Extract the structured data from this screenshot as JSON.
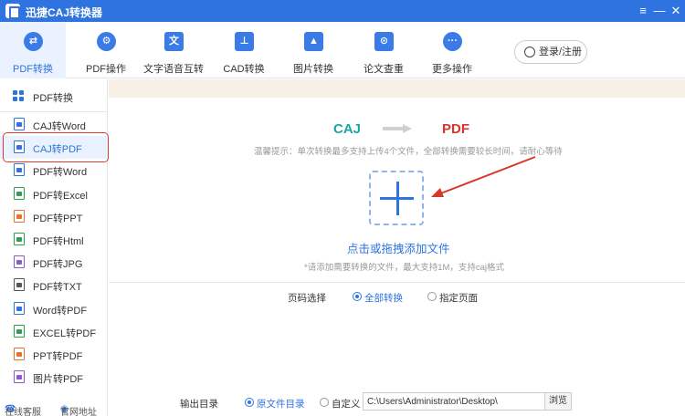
{
  "window": {
    "title": "迅捷CAJ转换器",
    "controls": {
      "menu": "≡",
      "minimize": "—",
      "close": "✕"
    }
  },
  "toolbar": {
    "tabs": [
      {
        "label": "PDF转换",
        "icon": "swap-icon",
        "active": true
      },
      {
        "label": "PDF操作",
        "icon": "gear-icon"
      },
      {
        "label": "文字语音互转",
        "icon": "speech-icon"
      },
      {
        "label": "CAD转换",
        "icon": "cad-icon"
      },
      {
        "label": "图片转换",
        "icon": "image-icon"
      },
      {
        "label": "论文查重",
        "icon": "search-doc-icon"
      },
      {
        "label": "更多操作",
        "icon": "more-icon"
      }
    ],
    "login_label": "登录/注册"
  },
  "sidebar": {
    "header": "PDF转换",
    "items": [
      {
        "label": "CAJ转Word",
        "color": "#2f73e0"
      },
      {
        "label": "CAJ转PDF",
        "color": "#2f73e0",
        "selected": true
      },
      {
        "label": "PDF转Word",
        "color": "#2f73e0"
      },
      {
        "label": "PDF转Excel",
        "color": "#2aa14a"
      },
      {
        "label": "PDF转PPT",
        "color": "#e8732a"
      },
      {
        "label": "PDF转Html",
        "color": "#2aa14a"
      },
      {
        "label": "PDF转JPG",
        "color": "#8e57d6"
      },
      {
        "label": "PDF转TXT",
        "color": "#555555"
      },
      {
        "label": "Word转PDF",
        "color": "#2f73e0"
      },
      {
        "label": "EXCEL转PDF",
        "color": "#2aa14a"
      },
      {
        "label": "PPT转PDF",
        "color": "#e8732a"
      },
      {
        "label": "图片转PDF",
        "color": "#8e57d6"
      }
    ],
    "footer": {
      "service": "在线客服",
      "website": "官网地址"
    }
  },
  "main": {
    "from_format": "CAJ",
    "to_format": "PDF",
    "tip": "温馨提示：单次转换最多支持上传4个文件，全部转换需要较长时间，请耐心等待",
    "drop_title": "点击或拖拽添加文件",
    "drop_subtitle": "*请添加需要转换的文件，最大支持1M，支持caj格式",
    "page_select": {
      "label": "页码选择",
      "options": [
        {
          "label": "全部转换",
          "selected": true
        },
        {
          "label": "指定页面",
          "selected": false
        }
      ]
    },
    "output": {
      "label": "输出目录",
      "options": [
        {
          "label": "原文件目录",
          "selected": true
        },
        {
          "label": "自定义",
          "selected": false
        }
      ],
      "path": "C:\\Users\\Administrator\\Desktop\\",
      "browse_label": "浏览"
    }
  },
  "colors": {
    "accent": "#2f73e0",
    "from_format": "#20a39e",
    "to_format": "#d9352b",
    "highlight_box": "#e03a2f"
  }
}
